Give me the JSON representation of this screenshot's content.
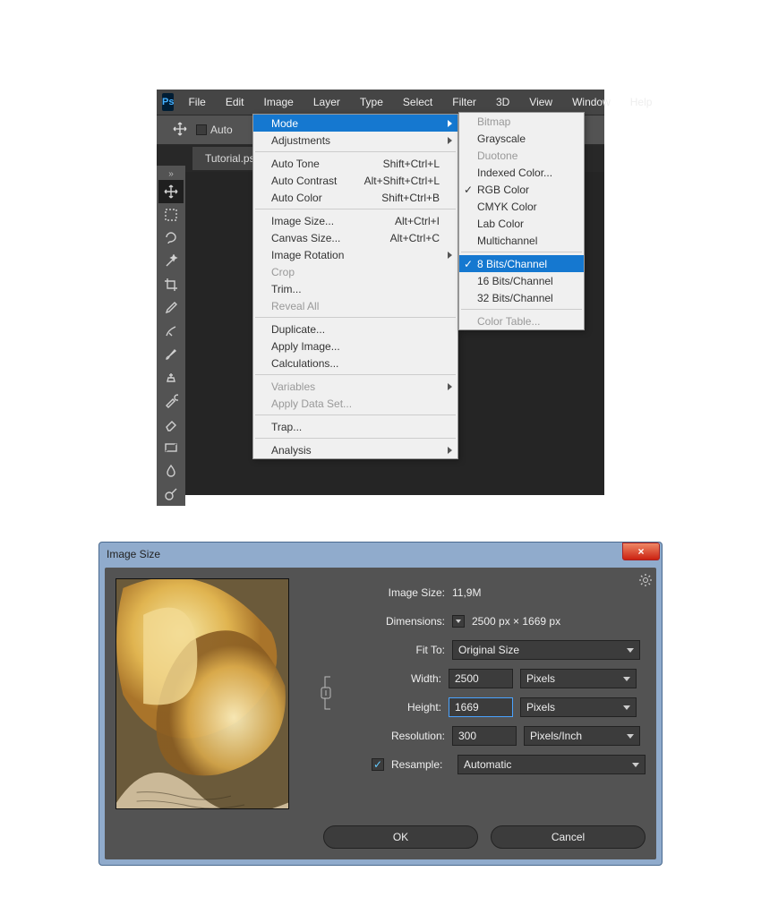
{
  "menubar": {
    "items": [
      "File",
      "Edit",
      "Image",
      "Layer",
      "Type",
      "Select",
      "Filter",
      "3D",
      "View",
      "Window",
      "Help"
    ],
    "open_index": 2,
    "ps_logo_text": "Ps"
  },
  "options_bar": {
    "auto_select_label": "Auto"
  },
  "document_tab": {
    "label": "Tutorial.ps"
  },
  "image_menu": [
    {
      "label": "Mode",
      "submenu": true,
      "hl": true
    },
    {
      "label": "Adjustments",
      "submenu": true,
      "sep_after": true
    },
    {
      "label": "Auto Tone",
      "shortcut": "Shift+Ctrl+L"
    },
    {
      "label": "Auto Contrast",
      "shortcut": "Alt+Shift+Ctrl+L"
    },
    {
      "label": "Auto Color",
      "shortcut": "Shift+Ctrl+B",
      "sep_after": true
    },
    {
      "label": "Image Size...",
      "shortcut": "Alt+Ctrl+I"
    },
    {
      "label": "Canvas Size...",
      "shortcut": "Alt+Ctrl+C"
    },
    {
      "label": "Image Rotation",
      "submenu": true
    },
    {
      "label": "Crop",
      "disabled": true
    },
    {
      "label": "Trim..."
    },
    {
      "label": "Reveal All",
      "disabled": true,
      "sep_after": true
    },
    {
      "label": "Duplicate..."
    },
    {
      "label": "Apply Image..."
    },
    {
      "label": "Calculations...",
      "sep_after": true
    },
    {
      "label": "Variables",
      "disabled": true,
      "submenu": true
    },
    {
      "label": "Apply Data Set...",
      "disabled": true,
      "sep_after": true
    },
    {
      "label": "Trap...",
      "sep_after": true
    },
    {
      "label": "Analysis",
      "submenu": true
    }
  ],
  "mode_submenu": [
    {
      "label": "Bitmap",
      "disabled": true
    },
    {
      "label": "Grayscale"
    },
    {
      "label": "Duotone",
      "disabled": true
    },
    {
      "label": "Indexed Color..."
    },
    {
      "label": "RGB Color",
      "checked": true
    },
    {
      "label": "CMYK Color"
    },
    {
      "label": "Lab Color"
    },
    {
      "label": "Multichannel",
      "sep_after": true
    },
    {
      "label": "8 Bits/Channel",
      "checked": true,
      "hl": true
    },
    {
      "label": "16 Bits/Channel"
    },
    {
      "label": "32 Bits/Channel",
      "sep_after": true
    },
    {
      "label": "Color Table...",
      "disabled": true
    }
  ],
  "tools": [
    "move",
    "marquee",
    "lasso",
    "magic-wand",
    "crop",
    "eyedropper",
    "healing-brush",
    "brush",
    "clone-stamp",
    "history-brush",
    "eraser",
    "gradient",
    "blur",
    "dodge"
  ],
  "image_size_dialog": {
    "title": "Image Size",
    "image_size_label": "Image Size:",
    "image_size_value": "11,9M",
    "dimensions_label": "Dimensions:",
    "dimensions_value": "2500 px  ×  1669 px",
    "fit_to_label": "Fit To:",
    "fit_to_value": "Original Size",
    "width_label": "Width:",
    "width_value": "2500",
    "width_unit": "Pixels",
    "height_label": "Height:",
    "height_value": "1669",
    "height_unit": "Pixels",
    "resolution_label": "Resolution:",
    "resolution_value": "300",
    "resolution_unit": "Pixels/Inch",
    "resample_label": "Resample:",
    "resample_value": "Automatic",
    "ok_label": "OK",
    "cancel_label": "Cancel",
    "close_label": "×"
  },
  "colors": {
    "hl": "#1578d0",
    "panel": "#535353",
    "dark": "#454545"
  }
}
